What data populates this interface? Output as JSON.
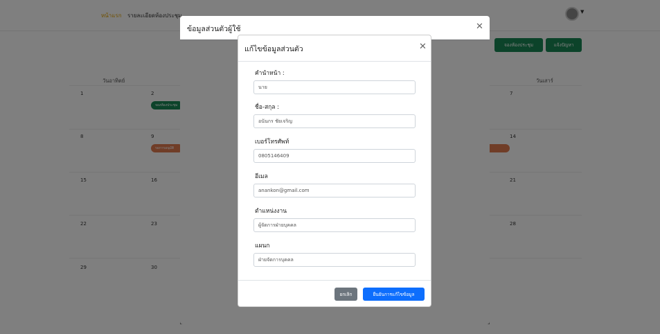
{
  "nav": {
    "home": "หน้าแรก",
    "room_details": "รายละเอียดห้องประชุม"
  },
  "actions": {
    "book_room": "จองห้องประชุม",
    "report_problem": "แจ้งปัญหา"
  },
  "calendar": {
    "first_day_header": "วันอาทิตย์",
    "last_day_header": "วันเสาร์",
    "day_numbers": {
      "r1c1": "1",
      "r1c2": "2",
      "r1c7": "7",
      "r2c1": "8",
      "r2c2": "9",
      "r2c7": "14",
      "r3c1": "15",
      "r3c2": "16",
      "r3c7": "21",
      "r4c1": "22",
      "r4c2": "23",
      "r4c7": "28",
      "r5c1": "29",
      "r5c2": "30"
    },
    "events": {
      "green": "จองห้องประชุม",
      "orange": "รอการอนุมัติ"
    }
  },
  "outer_modal": {
    "title": "ข้อมูลส่วนตัวผู้ใช้"
  },
  "edit_modal": {
    "title": "แก้ไขข้อมูลส่วนตัว",
    "fields": {
      "prefix": {
        "label": "คำนำหน้า :",
        "value": "นาย"
      },
      "fullname": {
        "label": "ชื่อ-สกุล :",
        "value": "อนันกร ชัยเจริญ"
      },
      "phone": {
        "label": "เบอร์โทรศัพท์",
        "value": "0805146409"
      },
      "email": {
        "label": "อีเมล",
        "value": "anankon@gmail.com"
      },
      "position": {
        "label": "ตำแหน่งงาน",
        "value": "ผู้จัดการฝ่ายบุคคล"
      },
      "department": {
        "label": "แผนก",
        "value": "ฝ่ายจัดการบุคคล"
      }
    },
    "cancel_label": "ยกเลิก",
    "confirm_label": "ยืนยันการแก้ไขข้อมูล"
  },
  "icons": {
    "close": "close-icon",
    "avatar": "user-avatar",
    "caret": "chevron-down-icon"
  },
  "colors": {
    "nav_active": "#e0a100",
    "green": "#198754",
    "primary": "#0d6efd",
    "secondary": "#6c757d",
    "event_orange": "#e07a4f"
  }
}
